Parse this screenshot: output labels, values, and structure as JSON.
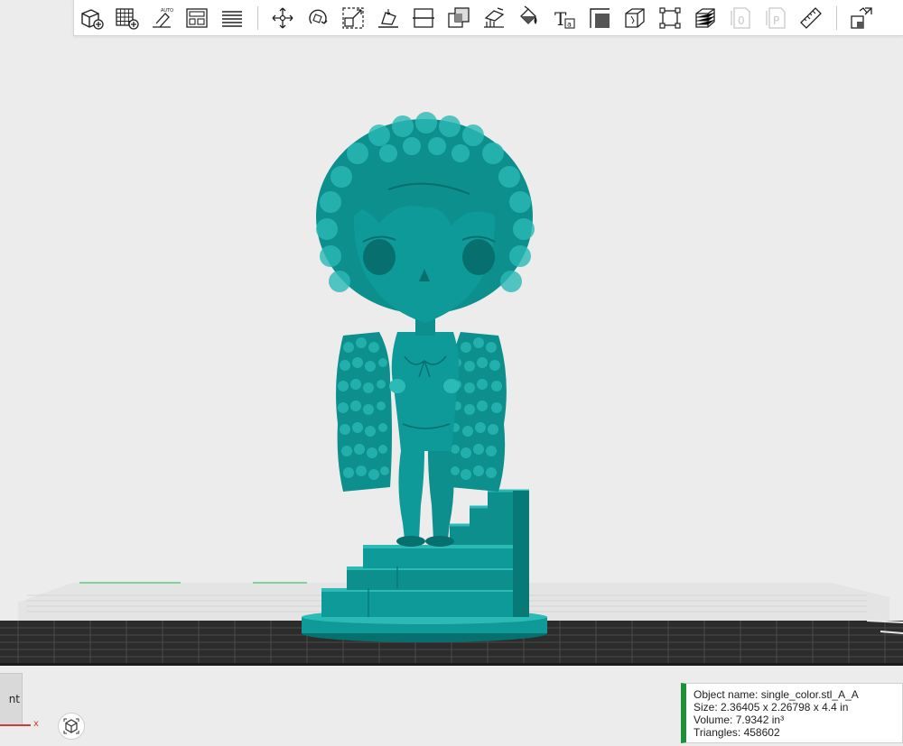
{
  "toolbar": {
    "tools": [
      {
        "icon": "add-object-icon",
        "enabled": true
      },
      {
        "icon": "add-plate-icon",
        "enabled": true
      },
      {
        "icon": "auto-orient-icon",
        "label": "AUTO",
        "enabled": true
      },
      {
        "icon": "arrange-icon",
        "enabled": true
      },
      {
        "icon": "layers-list-icon",
        "enabled": true
      },
      {
        "icon": "move-icon",
        "enabled": true
      },
      {
        "icon": "rotate-icon",
        "enabled": true
      },
      {
        "icon": "scale-icon",
        "enabled": true
      },
      {
        "icon": "lay-on-face-icon",
        "enabled": true
      },
      {
        "icon": "cut-icon",
        "enabled": true
      },
      {
        "icon": "boolean-icon",
        "enabled": true
      },
      {
        "icon": "support-paint-icon",
        "enabled": true
      },
      {
        "icon": "color-paint-icon",
        "enabled": true
      },
      {
        "icon": "text-emboss-icon",
        "label": "T",
        "enabled": true
      },
      {
        "icon": "seam-icon",
        "enabled": true
      },
      {
        "icon": "measure-cube-icon",
        "enabled": true
      },
      {
        "icon": "fit-frame-icon",
        "enabled": true
      },
      {
        "icon": "variable-layer-icon",
        "enabled": true
      },
      {
        "icon": "object-zero-icon",
        "label": "0",
        "enabled": false
      },
      {
        "icon": "object-plate-icon",
        "label": "P",
        "enabled": false
      },
      {
        "icon": "ruler-icon",
        "enabled": true
      },
      {
        "icon": "assembly-icon",
        "enabled": true
      }
    ]
  },
  "colors": {
    "model": "#0e9a98",
    "model_dark": "#076f6e",
    "model_light": "#2bbab6",
    "plate_grid": "#2e2e2e",
    "info_accent": "#1f8f3a",
    "background": "#ececec"
  },
  "left_panel": {
    "label": "nt"
  },
  "axis": {
    "x_label": "x"
  },
  "object_info": {
    "name": "Object name: single_color.stl_A_A",
    "size": "Size: 2.36405 x 2.26798 x 4.4 in",
    "volume": "Volume: 7.9342 in³",
    "triangles": "Triangles: 458602"
  }
}
